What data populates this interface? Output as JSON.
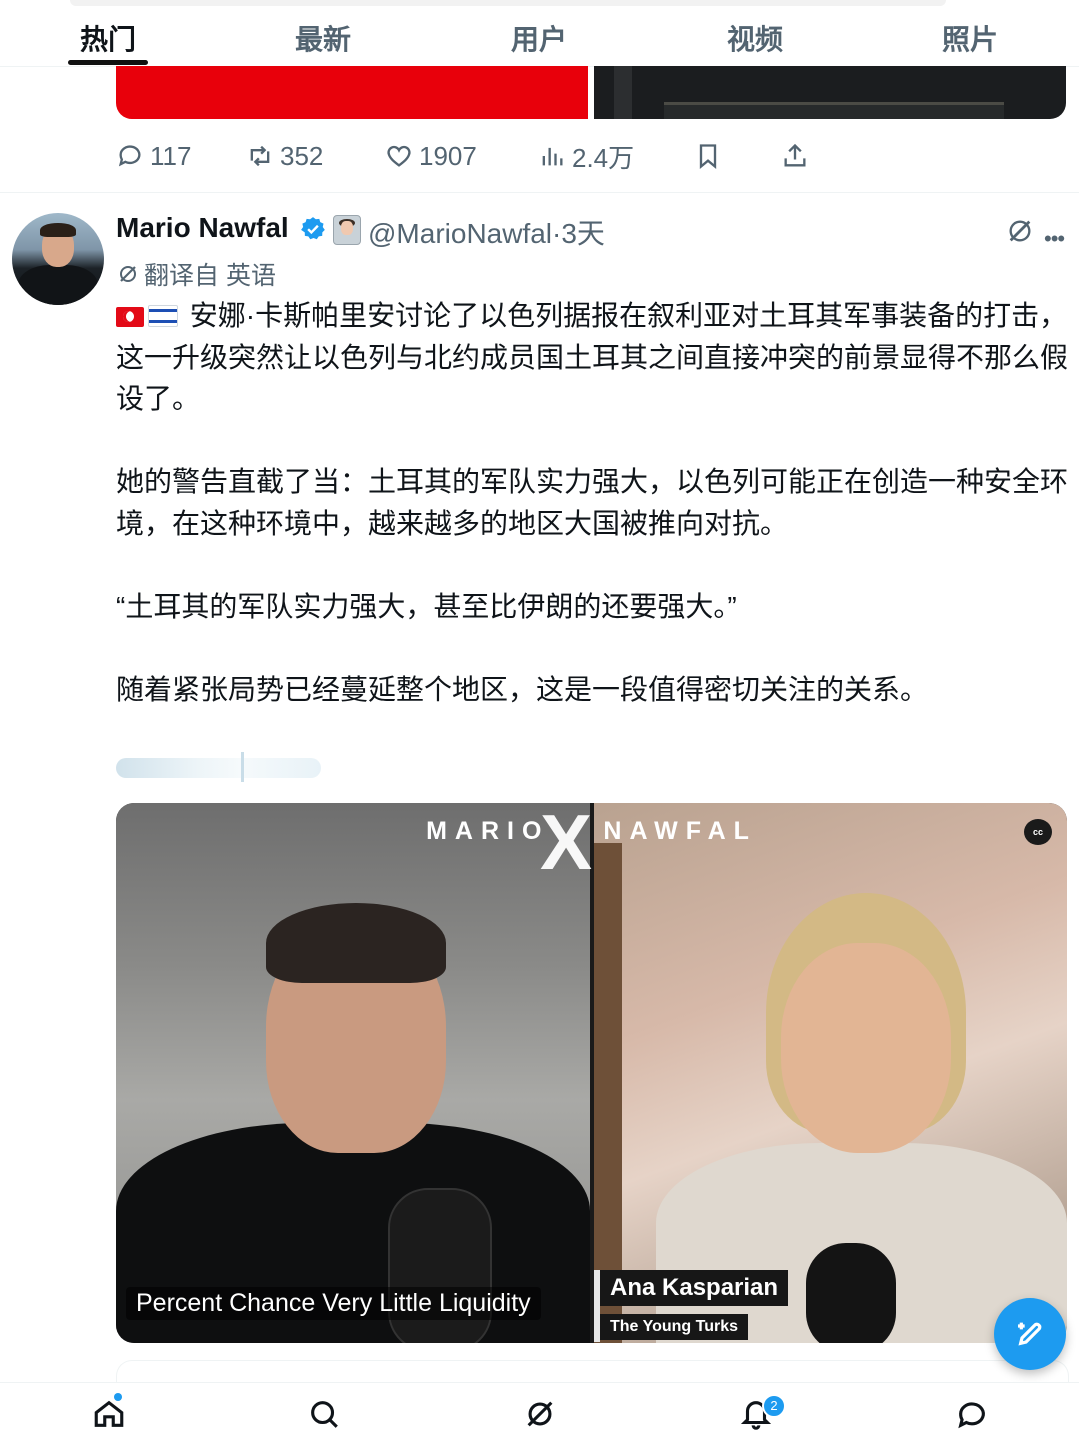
{
  "tabs": [
    {
      "label": "热门",
      "active": true
    },
    {
      "label": "最新",
      "active": false
    },
    {
      "label": "用户",
      "active": false
    },
    {
      "label": "视频",
      "active": false
    },
    {
      "label": "照片",
      "active": false
    }
  ],
  "prev_tweet": {
    "replies": "117",
    "reposts": "352",
    "likes": "1907",
    "views": "2.4万"
  },
  "tweet": {
    "author_name": "Mario Nawfal",
    "handle_time": "@MarioNawfal·3天",
    "translated_label": "翻译自 英语",
    "paragraphs": [
      "安娜·卡斯帕里安讨论了以色列据报在叙利亚对土耳其军事装备的打击，这一升级突然让以色列与北约成员国土耳其之间直接冲突的前景显得不那么假设了。",
      "她的警告直截了当：土耳其的军队实力强大，以色列可能正在创造一种安全环境，在这种环境中，越来越多的地区大国被推向对抗。",
      "“土耳其的军队实力强大，甚至比伊朗的还要强大。”",
      "随着紧张局势已经蔓延整个地区，这是一段值得密切关注的关系。"
    ],
    "video": {
      "brand_left": "MARIO",
      "brand_x": "X",
      "brand_right": "NAWFAL",
      "cc_label": "cc",
      "caption": "Percent Chance Very Little Liquidity",
      "guest_name": "Ana Kasparian",
      "guest_show": "The Young Turks"
    }
  },
  "notifications_count": "2",
  "colors": {
    "accent": "#1d9bf0",
    "text_primary": "#0f1419",
    "text_secondary": "#536471",
    "verified": "#1d9bf0"
  }
}
